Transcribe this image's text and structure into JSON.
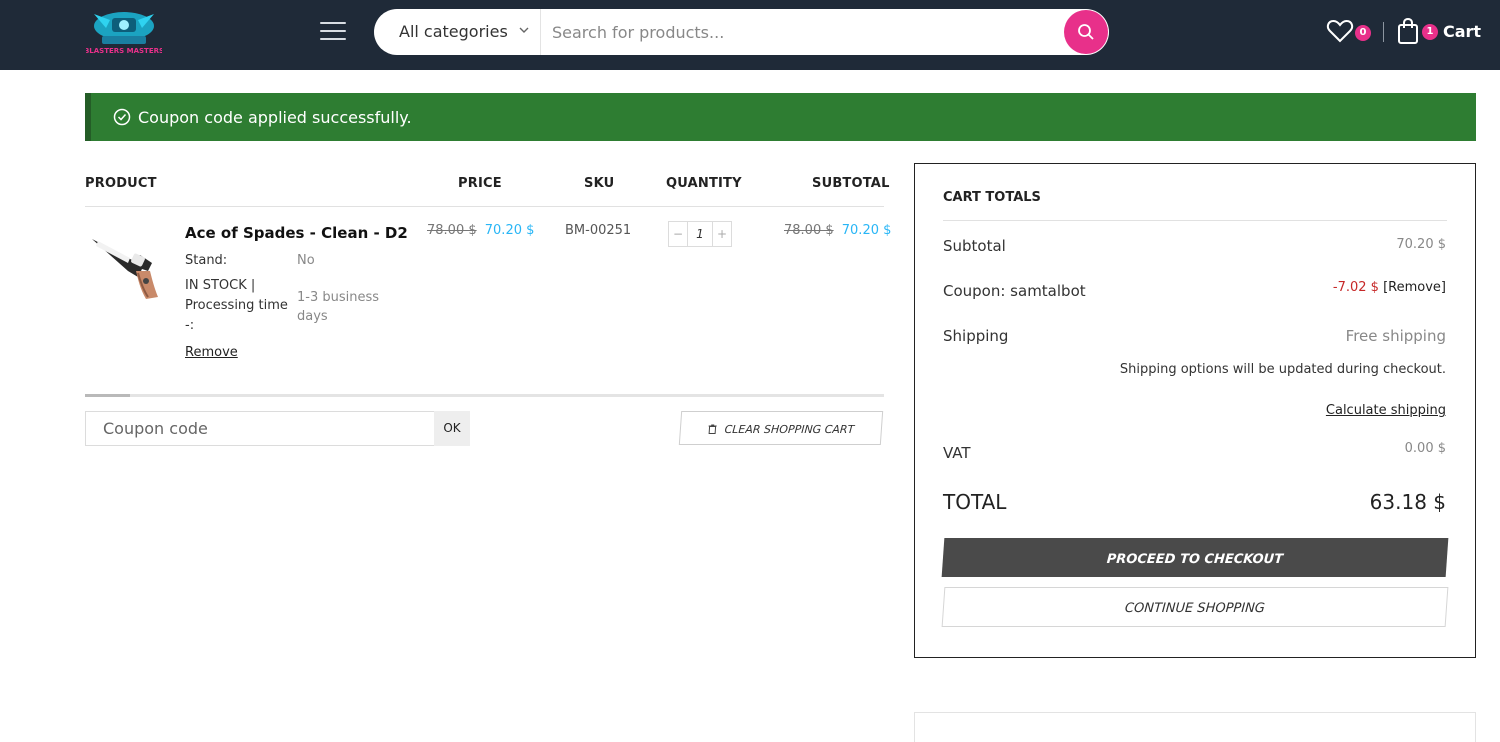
{
  "header": {
    "logo_text": "BLASTERS MASTERS",
    "category_select": "All categories",
    "search_placeholder": "Search for products...",
    "wishlist_count": "0",
    "cart_count": "1",
    "cart_label": "Cart",
    "colors": {
      "bar": "#1f2a38",
      "accent": "#e8308a"
    }
  },
  "notice": {
    "text": "Coupon code applied successfully.",
    "color": "#2e7d32"
  },
  "table": {
    "headers": {
      "product": "PRODUCT",
      "price": "PRICE",
      "sku": "SKU",
      "quantity": "QUANTITY",
      "subtotal": "SUBTOTAL"
    },
    "rows": [
      {
        "name": "Ace of Spades - Clean - D2",
        "meta": [
          {
            "label": "Stand:",
            "value": "No"
          },
          {
            "label": "IN STOCK | Processing time -:",
            "value": "1-3 business days"
          }
        ],
        "remove_label": "Remove",
        "price_old": "78.00 $",
        "price_new": "70.20 $",
        "sku": "BM-00251",
        "quantity": "1",
        "qty_minus": "−",
        "qty_plus": "+",
        "subtotal_old": "78.00 $",
        "subtotal_new": "70.20 $"
      }
    ]
  },
  "coupon": {
    "placeholder": "Coupon code",
    "ok_label": "OK",
    "clear_label": "CLEAR SHOPPING CART",
    "clear_icon": "trash-icon"
  },
  "totals": {
    "title": "CART TOTALS",
    "subtotal_label": "Subtotal",
    "subtotal_value": "70.20 $",
    "coupon_label": "Coupon: samtalbot",
    "coupon_value": "-7.02 $",
    "coupon_remove": "[Remove]",
    "shipping_label": "Shipping",
    "shipping_value": "Free shipping",
    "shipping_note": "Shipping options will be updated during checkout.",
    "calc_shipping": "Calculate shipping",
    "vat_label": "VAT",
    "vat_value": "0.00 $",
    "total_label": "TOTAL",
    "total_value": "63.18 $",
    "checkout_label": "PROCEED TO CHECKOUT",
    "continue_label": "CONTINUE SHOPPING"
  }
}
